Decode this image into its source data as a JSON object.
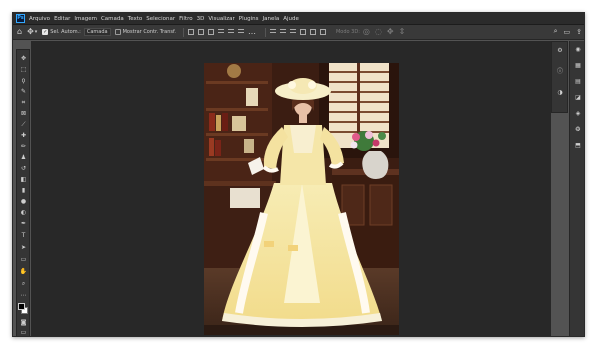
{
  "app": {
    "logo_text": "Ps"
  },
  "menu": [
    "Arquivo",
    "Editar",
    "Imagem",
    "Camada",
    "Texto",
    "Selecionar",
    "Filtro",
    "3D",
    "Visualizar",
    "Plugins",
    "Janela",
    "Ajude"
  ],
  "options_bar": {
    "auto_select_label": "Sel. Autom.:",
    "auto_select_target": "Camada",
    "show_transform_label": "Mostrar Contr. Transf.",
    "mode_3d_label": "Modo 3D:"
  },
  "toolbar": {
    "tools": [
      "move",
      "marquee",
      "lasso",
      "quick-select",
      "crop",
      "frame",
      "eyedropper",
      "healing",
      "brush",
      "stamp",
      "history-brush",
      "eraser",
      "gradient",
      "blur",
      "dodge",
      "pen",
      "type",
      "path-select",
      "rectangle",
      "hand",
      "zoom",
      "more"
    ]
  },
  "colors": {
    "foreground": "#000000",
    "background": "#ffffff",
    "accent": "#31a8ff"
  }
}
